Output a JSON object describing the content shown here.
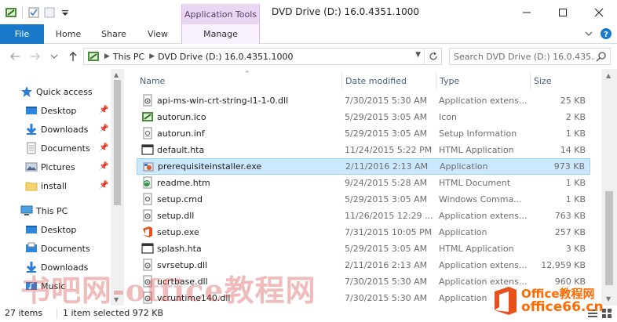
{
  "window": {
    "title": "DVD Drive (D:) 16.0.4351.1000",
    "contextual_tab_group": "Application Tools"
  },
  "ribbon": {
    "tabs": [
      {
        "label": "File"
      },
      {
        "label": "Home"
      },
      {
        "label": "Share"
      },
      {
        "label": "View"
      },
      {
        "label": "Manage"
      }
    ]
  },
  "address": {
    "crumbs": [
      "This PC",
      "DVD Drive (D:) 16.0.4351.1000"
    ],
    "search_placeholder": "Search DVD Drive (D:) 16.0.435..."
  },
  "nav": {
    "quick_access": "Quick access",
    "quick_items": [
      {
        "label": "Desktop",
        "icon": "desktop-folder-icon"
      },
      {
        "label": "Downloads",
        "icon": "downloads-icon"
      },
      {
        "label": "Documents",
        "icon": "documents-icon"
      },
      {
        "label": "Pictures",
        "icon": "pictures-icon"
      },
      {
        "label": "install",
        "icon": "folder-icon"
      }
    ],
    "this_pc": "This PC",
    "pc_items": [
      {
        "label": "Desktop",
        "icon": "desktop-folder-icon"
      },
      {
        "label": "Documents",
        "icon": "documents-icon"
      },
      {
        "label": "Downloads",
        "icon": "downloads-icon"
      },
      {
        "label": "Music",
        "icon": "music-icon"
      }
    ]
  },
  "columns": {
    "name": "Name",
    "date": "Date modified",
    "type": "Type",
    "size": "Size"
  },
  "files": [
    {
      "name": "api-ms-win-crt-string-l1-1-0.dll",
      "date": "7/30/2015 5:30 AM",
      "type": "Application extens...",
      "size": "25 KB",
      "icon": "dll-file-icon"
    },
    {
      "name": "autorun.ico",
      "date": "5/29/2015 3:05 AM",
      "type": "Icon",
      "size": "2 KB",
      "icon": "ico-file-icon"
    },
    {
      "name": "autorun.inf",
      "date": "5/29/2015 3:05 AM",
      "type": "Setup Information",
      "size": "1 KB",
      "icon": "inf-file-icon"
    },
    {
      "name": "default.hta",
      "date": "11/24/2015 5:22 PM",
      "type": "HTML Application",
      "size": "14 KB",
      "icon": "hta-file-icon"
    },
    {
      "name": "prerequisiteinstaller.exe",
      "date": "2/11/2016 2:13 AM",
      "type": "Application",
      "size": "973 KB",
      "icon": "installer-exe-icon",
      "selected": true
    },
    {
      "name": "readme.htm",
      "date": "9/24/2015 5:28 AM",
      "type": "HTML Document",
      "size": "1 KB",
      "icon": "htm-file-icon"
    },
    {
      "name": "setup.cmd",
      "date": "5/29/2015 3:05 AM",
      "type": "Windows Comma...",
      "size": "1 KB",
      "icon": "cmd-file-icon"
    },
    {
      "name": "setup.dll",
      "date": "11/26/2015 12:29 ...",
      "type": "Application extens...",
      "size": "763 KB",
      "icon": "dll-file-icon"
    },
    {
      "name": "setup.exe",
      "date": "7/31/2015 10:05 PM",
      "type": "Application",
      "size": "257 KB",
      "icon": "office-exe-icon"
    },
    {
      "name": "splash.hta",
      "date": "5/29/2015 3:05 AM",
      "type": "HTML Application",
      "size": "3 KB",
      "icon": "hta-file-icon"
    },
    {
      "name": "svrsetup.dll",
      "date": "2/11/2016 2:13 AM",
      "type": "Application extens...",
      "size": "12,959 KB",
      "icon": "dll-file-icon"
    },
    {
      "name": "ucrtbase.dll",
      "date": "7/30/2015 5:30 AM",
      "type": "Application extens...",
      "size": "960 KB",
      "icon": "dll-file-icon"
    },
    {
      "name": "vcruntime140.dll",
      "date": "7/30/2015 5:30 AM",
      "type": "Application",
      "size": "",
      "icon": "dll-file-icon"
    }
  ],
  "status": {
    "item_count": "27 items",
    "selection": "1 item selected  972 KB"
  },
  "watermark": {
    "text": "书吧网-office教程网",
    "logo_top": "Office教程网",
    "logo_bottom": "office66.cn"
  },
  "colors": {
    "accent": "#1979ca",
    "selection_bg": "#cce8ff",
    "selection_border": "#99d1ff",
    "contextual_tab": "#e8d6f2",
    "watermark_orange": "#ff6a00"
  }
}
